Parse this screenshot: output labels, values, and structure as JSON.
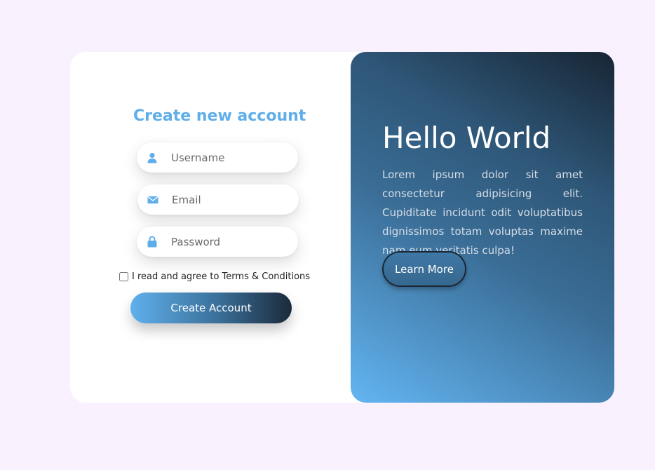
{
  "form": {
    "title": "Create new account",
    "username_placeholder": "Username",
    "email_placeholder": "Email",
    "password_placeholder": "Password",
    "terms_label": "I read and agree to Terms & Conditions",
    "terms_checked": false,
    "submit_label": "Create Account",
    "icons": [
      "user-icon",
      "envelope-icon",
      "lock-icon"
    ],
    "accent_color": "#5faeea"
  },
  "panel": {
    "heading": "Hello World",
    "body": "Lorem ipsum dolor sit amet consectetur adipisicing elit. Cupiditate incidunt odit voluptatibus dignissimos totam voluptas maxime nam eum veritatis culpa!",
    "button_label": "Learn More"
  }
}
